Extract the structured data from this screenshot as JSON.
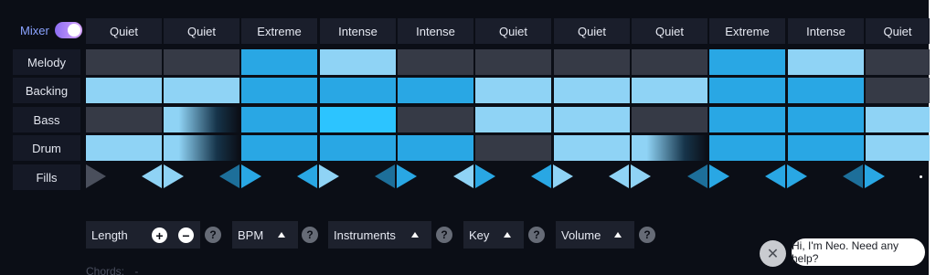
{
  "mixer": {
    "label": "Mixer",
    "enabled": true
  },
  "section_labels": [
    "Quiet",
    "Quiet",
    "Extreme",
    "Intense",
    "Intense",
    "Quiet",
    "Quiet",
    "Quiet",
    "Extreme",
    "Intense",
    "Quiet"
  ],
  "tracks": [
    {
      "name": "Melody",
      "cells": [
        "dark",
        "dark",
        "mid",
        "light",
        "dark",
        "dark",
        "dark",
        "dark",
        "mid",
        "light",
        "dark"
      ]
    },
    {
      "name": "Backing",
      "cells": [
        "light",
        "light",
        "mid",
        "mid",
        "mid",
        "light",
        "light",
        "light",
        "mid",
        "mid",
        "dark"
      ]
    },
    {
      "name": "Bass",
      "cells": [
        "dark",
        "fade",
        "mid",
        "bright",
        "dark",
        "light",
        "light",
        "dark",
        "mid",
        "mid",
        "light"
      ]
    },
    {
      "name": "Drum",
      "cells": [
        "light",
        "fade",
        "mid",
        "mid",
        "mid",
        "dark",
        "light",
        "fade",
        "mid",
        "mid",
        "light"
      ]
    }
  ],
  "fills_label": "Fills",
  "colors": {
    "dark": "#363a46",
    "light": "#8fd3f5",
    "mid": "#29a7e4",
    "bright": "#2cc4ff",
    "background": "#0b0e16"
  },
  "controls": {
    "length_label": "Length",
    "bpm_label": "BPM",
    "instruments_label": "Instruments",
    "key_label": "Key",
    "volume_label": "Volume",
    "plus_glyph": "+",
    "minus_glyph": "−",
    "help_glyph": "?"
  },
  "chords": {
    "label": "Chords:",
    "value": "-"
  },
  "chat": {
    "message": "Hi, I'm Neo. Need any help?",
    "close_glyph": "✕"
  },
  "icons": [
    "plus-icon",
    "minus-icon",
    "help-icon",
    "chevron-up-icon",
    "close-icon",
    "play-triangle-icon"
  ]
}
